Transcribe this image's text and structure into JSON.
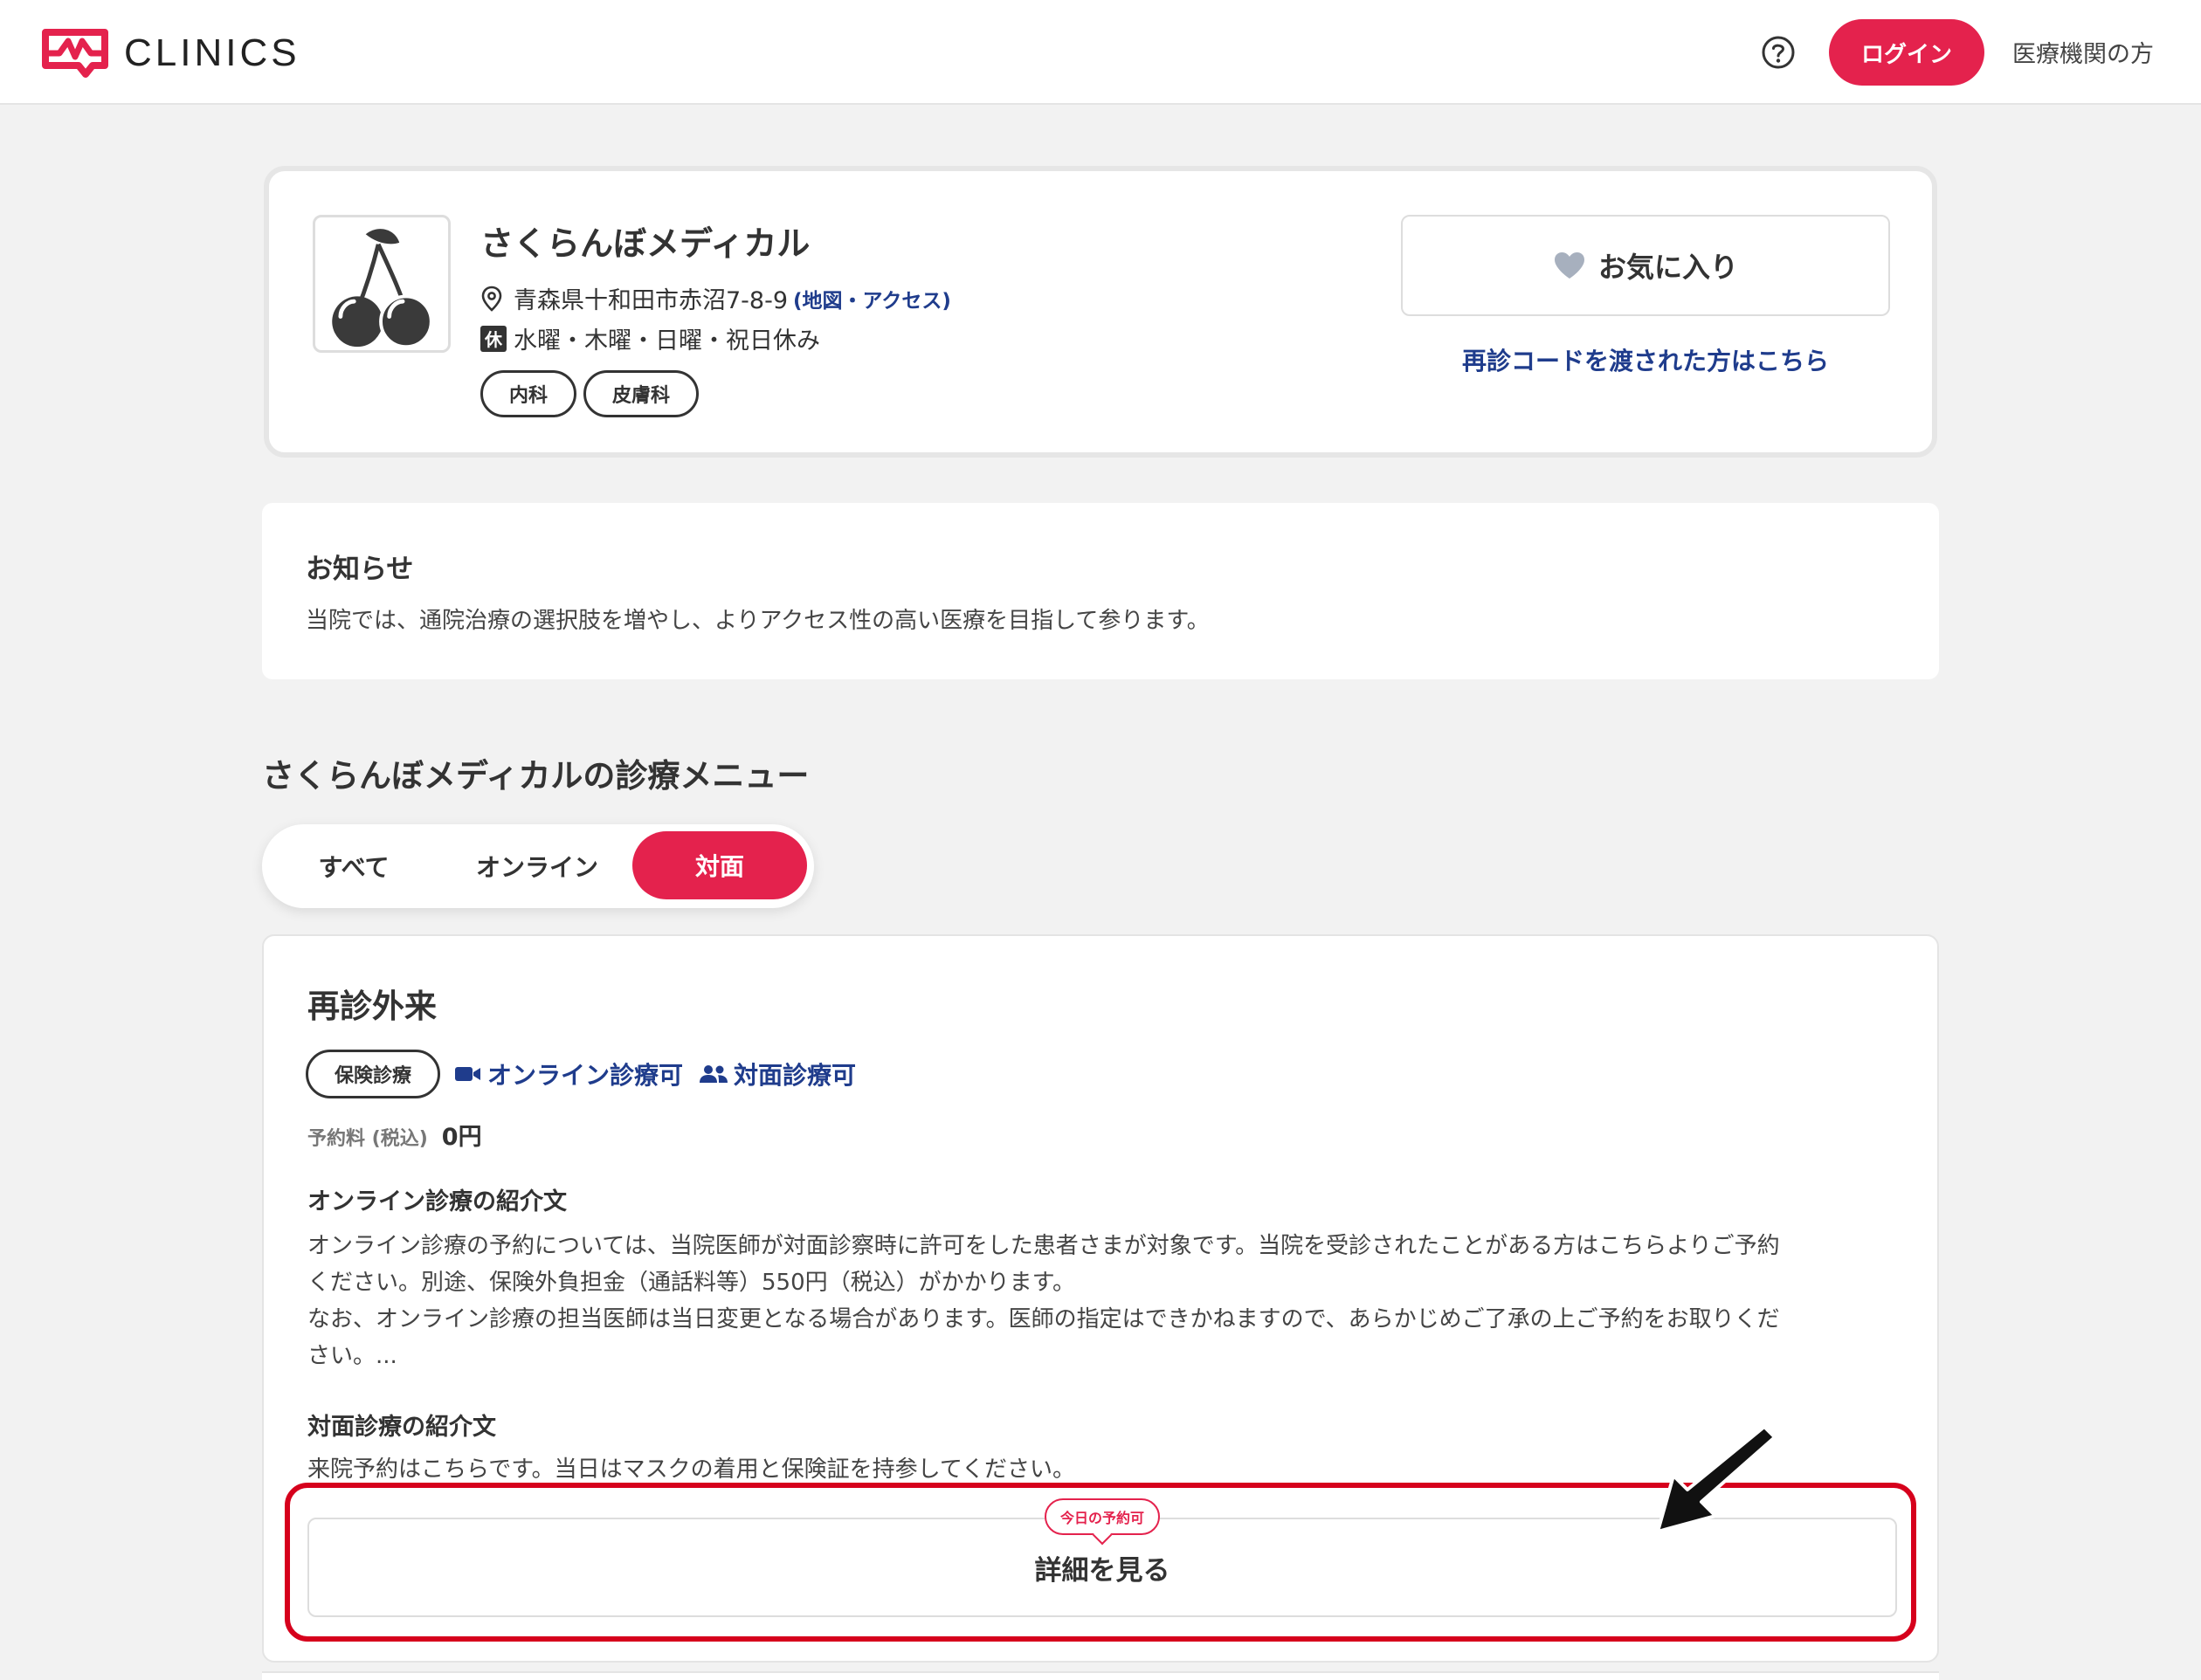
{
  "header": {
    "logo_text": "CLINICS",
    "login_label": "ログイン",
    "medical_link": "医療機関の方"
  },
  "clinic": {
    "name": "さくらんぼメディカル",
    "address": "青森県十和田市赤沼7-8-9",
    "address_link": "(地図・アクセス)",
    "holiday_badge": "休",
    "holidays": "水曜・木曜・日曜・祝日休み",
    "tags": [
      "内科",
      "皮膚科"
    ],
    "favorite_label": "お気に入り",
    "recode_link": "再診コードを渡された方はこちら"
  },
  "notice": {
    "title": "お知らせ",
    "text": "当院では、通院治療の選択肢を増やし、よりアクセス性の高い医療を目指して参ります。"
  },
  "menu": {
    "heading": "さくらんぼメディカルの診療メニュー",
    "tabs": [
      "すべて",
      "オンライン",
      "対面"
    ],
    "active_tab": "対面",
    "item": {
      "title": "再診外来",
      "insurance_badge": "保険診療",
      "online_feature": "オンライン診療可",
      "face_feature": "対面診療可",
      "fee_label": "予約料 (税込)",
      "fee_value": "0円",
      "online_intro_title": "オンライン診療の紹介文",
      "online_intro_lines": [
        "オンライン診療の予約については、当院医師が対面診察時に許可をした患者さまが対象です。当院を受診されたことがある方はこちらよりご予約",
        "ください。別途、保険外負担金（通話料等）550円（税込）がかかります。",
        "なお、オンライン診療の担当医師は当日変更となる場合があります。医師の指定はできかねますので、あらかじめご了承の上ご予約をお取りくだ",
        "さい。..."
      ],
      "face_intro_title": "対面診療の紹介文",
      "face_intro_text": "来院予約はこちらです。当日はマスクの着用と保険証を持参してください。",
      "today_badge": "今日の予約可",
      "detail_button": "詳細を見る"
    }
  },
  "colors": {
    "brand_red": "#e4224d",
    "link_blue": "#1f3c8c",
    "annotation_red": "#d6001c"
  }
}
